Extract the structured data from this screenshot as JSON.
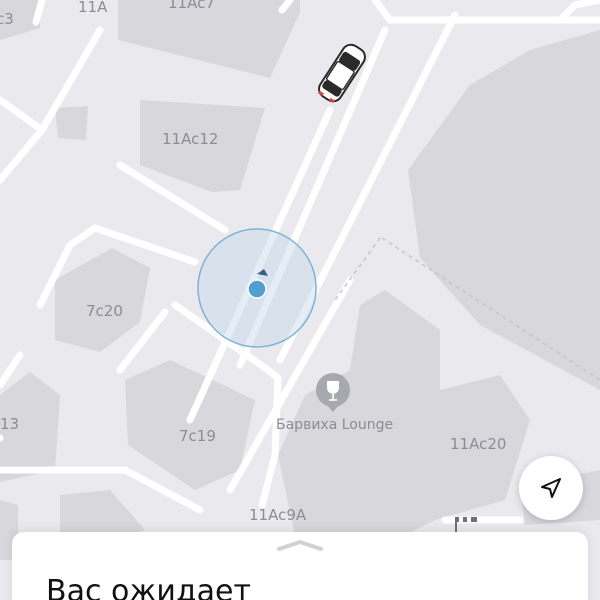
{
  "map": {
    "labels": {
      "b_11a": "11A",
      "b_11ac7": "11Ac7",
      "b_c3": "c3",
      "b_11ac12": "11Ac12",
      "b_7c20": "7c20",
      "b_13": "13",
      "b_7c19": "7c19",
      "b_11ac20": "11Ac20",
      "b_11ac9a": "11Ac9A"
    },
    "poi": {
      "name": "Барвиха Lounge",
      "icon": "wine-glass-icon"
    },
    "user_location_icon": "user-location-icon",
    "car_icon": "taxi-car-icon"
  },
  "controls": {
    "locate_icon": "navigation-arrow-icon"
  },
  "sheet": {
    "title": "Вас ожидает",
    "handle_icon": "chevron-up-icon"
  },
  "colors": {
    "map_bg": "#e9e9ee",
    "building": "#d7d7dc",
    "road": "#ffffff",
    "accuracy_fill": "#c6d8e8",
    "location_dot": "#4f9fd1",
    "car_roof": "#2a2a2a"
  }
}
